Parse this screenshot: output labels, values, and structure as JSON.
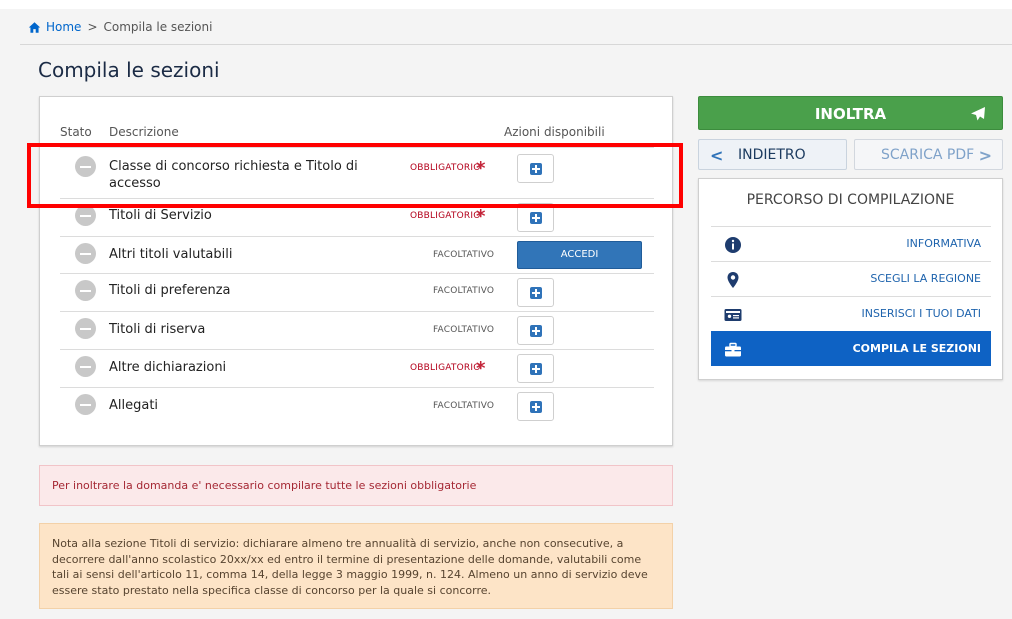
{
  "breadcrumb": {
    "home": "Home",
    "separator": ">",
    "current": "Compila le sezioni"
  },
  "page_title": "Compila le sezioni",
  "table": {
    "headers": {
      "stato": "Stato",
      "descrizione": "Descrizione",
      "azioni": "Azioni disponibili"
    },
    "rows": [
      {
        "line1": "Classe di concorso richiesta e Titolo di",
        "line2": "accesso",
        "badge": "OBBLIGATORIO",
        "required": true,
        "action": "plus"
      },
      {
        "line1": "Titoli di Servizio",
        "badge": "OBBLIGATORIO",
        "required": true,
        "action": "plus"
      },
      {
        "line1": "Altri titoli valutabili",
        "badge": "FACOLTATIVO",
        "required": false,
        "action": "accedi",
        "action_label": "ACCEDI"
      },
      {
        "line1": "Titoli di preferenza",
        "badge": "FACOLTATIVO",
        "required": false,
        "action": "plus"
      },
      {
        "line1": "Titoli di riserva",
        "badge": "FACOLTATIVO",
        "required": false,
        "action": "plus"
      },
      {
        "line1": "Altre dichiarazioni",
        "badge": "OBBLIGATORIO",
        "required": true,
        "action": "plus"
      },
      {
        "line1": "Allegati",
        "badge": "FACOLTATIVO",
        "required": false,
        "action": "plus"
      }
    ],
    "asterisk": "*"
  },
  "alerts": {
    "error": "Per inoltrare la domanda e' necessario compilare tutte le sezioni obbligatorie",
    "note": "Nota alla sezione Titoli di servizio: dichiarare almeno tre annualità di servizio, anche non consecutive, a decorrere dall'anno scolastico 20xx/xx ed entro il termine di presentazione delle domande, valutabili come tali ai sensi dell'articolo 11, comma 14, della legge 3 maggio 1999, n. 124. Almeno un anno di servizio deve essere stato prestato nella specifica classe di concorso per la quale si concorre."
  },
  "actions": {
    "inoltra": "INOLTRA",
    "indietro": "INDIETRO",
    "scarica": "SCARICA PDF",
    "chev_left": "<",
    "chev_right": ">"
  },
  "percorso": {
    "title": "PERCORSO DI COMPILAZIONE",
    "steps": [
      {
        "label": "INFORMATIVA",
        "icon": "info-icon"
      },
      {
        "label": "SCEGLI LA REGIONE",
        "icon": "map-pin-icon"
      },
      {
        "label": "INSERISCI I TUOI DATI",
        "icon": "id-card-icon"
      },
      {
        "label": "COMPILA LE SEZIONI",
        "icon": "briefcase-icon",
        "active": true
      }
    ]
  },
  "colors": {
    "primary": "#0066cc",
    "success": "#4aa04b",
    "danger": "#b3001b",
    "active_step": "#0e62c4",
    "highlight": "#ff0000"
  }
}
